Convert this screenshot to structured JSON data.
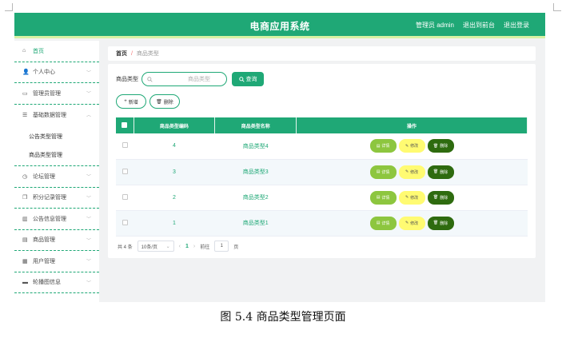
{
  "header": {
    "title": "电商应用系统",
    "links": [
      "管理员 admin",
      "退出到前台",
      "退出登录"
    ]
  },
  "sidebar": {
    "items": [
      {
        "label": "首页",
        "icon": "home-icon",
        "glyph": "⌂",
        "chevron": false
      },
      {
        "label": "个人中心",
        "icon": "user-icon",
        "glyph": "👤",
        "chevron": true
      },
      {
        "label": "管理员管理",
        "icon": "monitor-icon",
        "glyph": "▭",
        "chevron": true
      },
      {
        "label": "基础数据管理",
        "icon": "sliders-icon",
        "glyph": "☰",
        "chevron": true,
        "expanded": true,
        "children": [
          "公告类型管理",
          "商品类型管理"
        ]
      },
      {
        "label": "论坛管理",
        "icon": "clock-icon",
        "glyph": "◷",
        "chevron": true
      },
      {
        "label": "积分记录管理",
        "icon": "copy-icon",
        "glyph": "❐",
        "chevron": true
      },
      {
        "label": "公告信息管理",
        "icon": "chart-icon",
        "glyph": "▥",
        "chevron": true
      },
      {
        "label": "商品管理",
        "icon": "box-icon",
        "glyph": "▤",
        "chevron": true
      },
      {
        "label": "用户管理",
        "icon": "calendar-icon",
        "glyph": "▦",
        "chevron": true
      },
      {
        "label": "轮播图信息",
        "icon": "image-icon",
        "glyph": "▬",
        "chevron": true
      }
    ]
  },
  "breadcrumb": {
    "home": "首页",
    "separator": "/",
    "current": "商品类型"
  },
  "search": {
    "label": "商品类型",
    "placeholder": "商品类型",
    "button": "查询"
  },
  "actions": {
    "add": "新增",
    "delete": "删除"
  },
  "table": {
    "columns": [
      "商品类型编码",
      "商品类型名称",
      "操作"
    ],
    "rows": [
      {
        "code": "4",
        "name": "商品类型4"
      },
      {
        "code": "3",
        "name": "商品类型3"
      },
      {
        "code": "2",
        "name": "商品类型2"
      },
      {
        "code": "1",
        "name": "商品类型1"
      }
    ],
    "ops": {
      "detail": "详情",
      "edit": "修改",
      "delete": "删除"
    }
  },
  "pagination": {
    "total": "共 4 条",
    "page_size": "10条/页",
    "current_page": "1",
    "goto_label": "前往",
    "goto_value": "1",
    "page_suffix": "页"
  },
  "caption": "图 5.4  商品类型管理页面",
  "colors": {
    "primary": "#1fa876",
    "detail": "#8dc63f",
    "edit": "#fffb72",
    "delete": "#2e6b0f"
  }
}
